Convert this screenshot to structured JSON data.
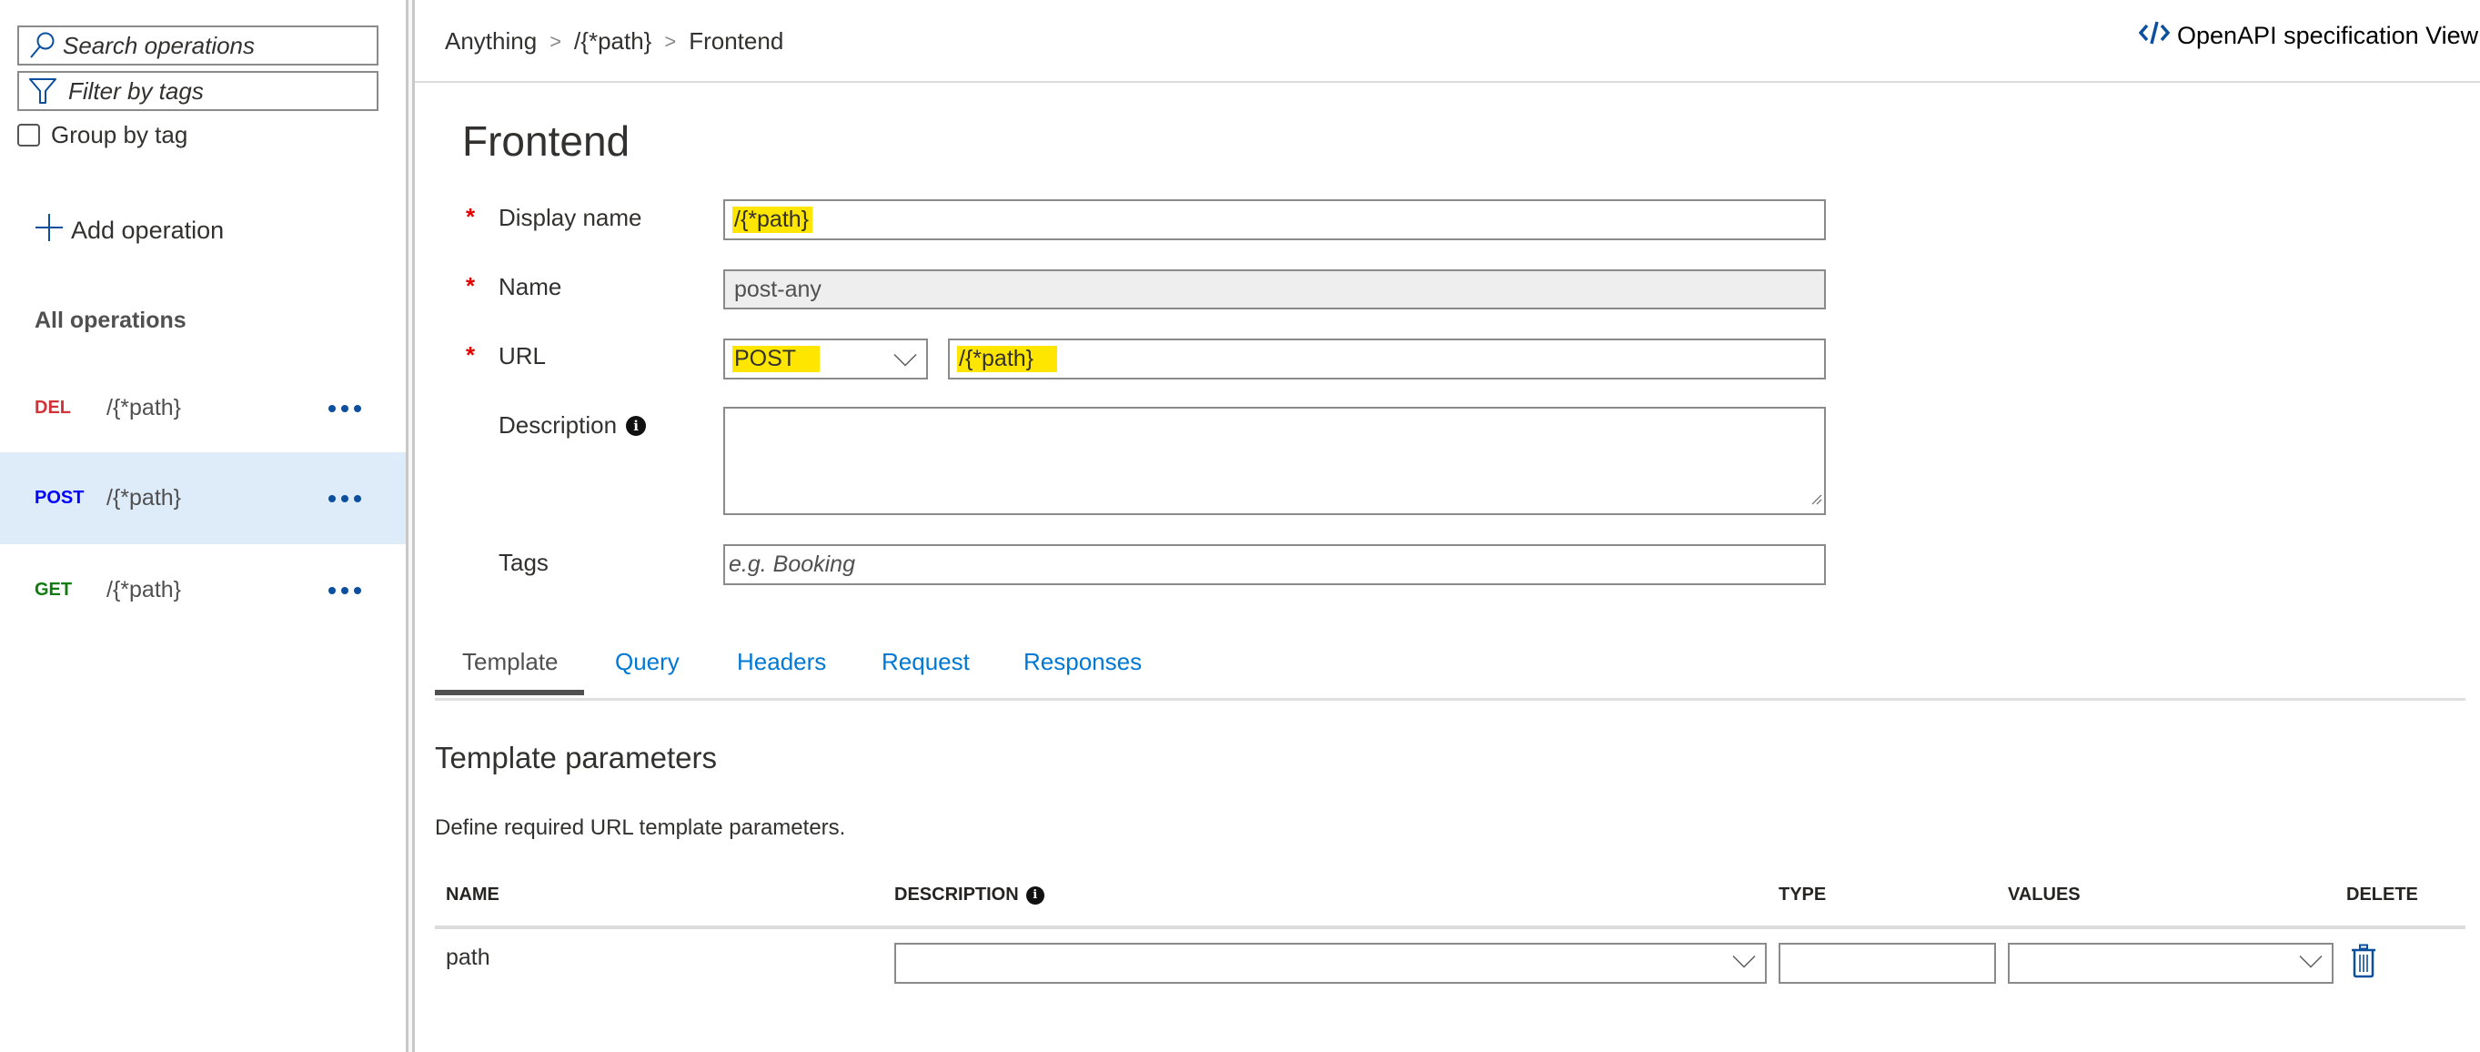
{
  "sidebar": {
    "search": {
      "placeholder": "Search operations",
      "value": ""
    },
    "filter": {
      "placeholder": "Filter by tags",
      "value": ""
    },
    "group_by_tag": {
      "label": "Group by tag",
      "checked": false
    },
    "add_operation_label": "Add operation",
    "all_operations_label": "All operations",
    "operations": [
      {
        "method": "DEL",
        "path": "/{*path}",
        "color": "#d13438",
        "selected": false
      },
      {
        "method": "POST",
        "path": "/{*path}",
        "color": "#0000ff",
        "selected": true
      },
      {
        "method": "GET",
        "path": "/{*path}",
        "color": "#107c10",
        "selected": false
      }
    ]
  },
  "header": {
    "breadcrumb": [
      "Anything",
      "/{*path}",
      "Frontend"
    ],
    "breadcrumb_separator": ">",
    "openapi_link": "OpenAPI specification View"
  },
  "form": {
    "title": "Frontend",
    "display_name": {
      "label": "Display name",
      "value": "/{*path}",
      "required": true
    },
    "name": {
      "label": "Name",
      "value": "post-any",
      "required": true,
      "disabled": true
    },
    "url": {
      "label": "URL",
      "method": "POST",
      "path": "/{*path}",
      "required": true
    },
    "description": {
      "label": "Description",
      "value": ""
    },
    "tags": {
      "label": "Tags",
      "placeholder": "e.g. Booking",
      "value": ""
    },
    "required_marker": "*",
    "info_glyph": "i"
  },
  "tabs": [
    {
      "label": "Template",
      "active": true
    },
    {
      "label": "Query",
      "active": false
    },
    {
      "label": "Headers",
      "active": false
    },
    {
      "label": "Request",
      "active": false
    },
    {
      "label": "Responses",
      "active": false
    }
  ],
  "template_params": {
    "title": "Template parameters",
    "description": "Define required URL template parameters.",
    "columns": [
      "NAME",
      "DESCRIPTION",
      "TYPE",
      "VALUES",
      "DELETE"
    ],
    "rows": [
      {
        "name": "path",
        "description": "",
        "type": "",
        "values": ""
      }
    ]
  },
  "colors": {
    "accent": "#0078d4",
    "selected_row_bg": "#deecf9",
    "highlight": "#ffe600",
    "required": "#e00000",
    "icon_blue": "#0b4f9e"
  }
}
